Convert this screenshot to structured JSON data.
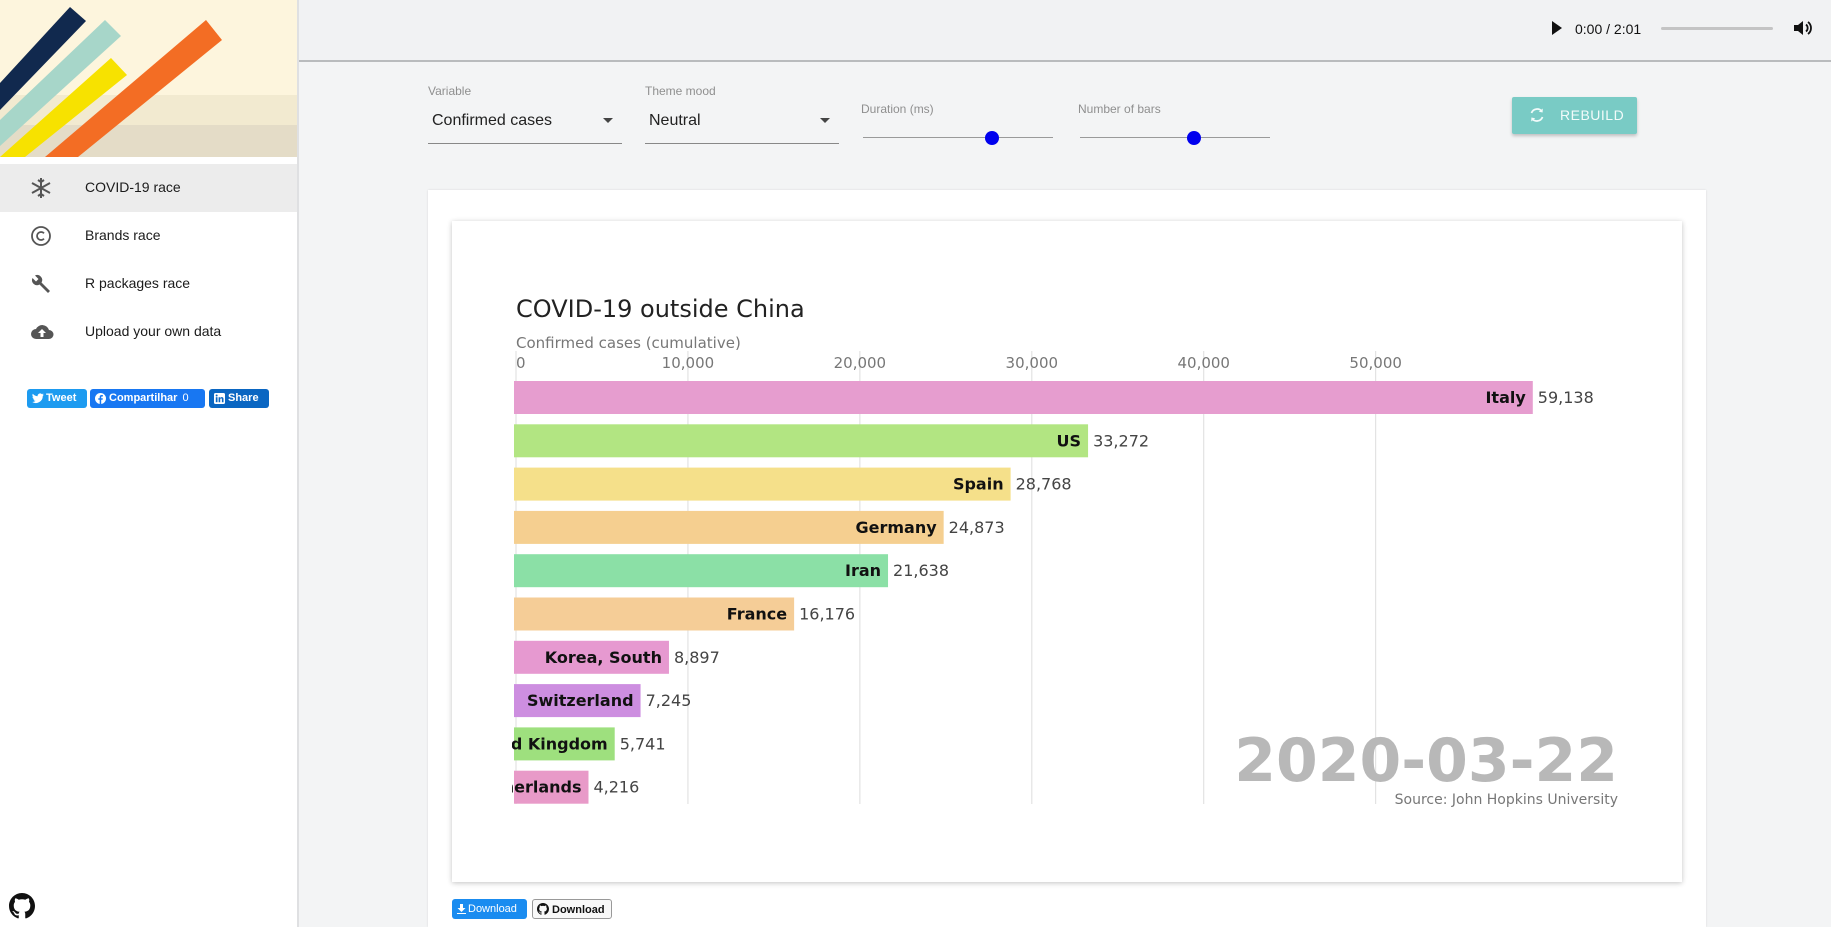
{
  "sidebar": {
    "items": [
      {
        "label": "COVID-19 race",
        "icon": "snowflake-icon",
        "active": true
      },
      {
        "label": "Brands race",
        "icon": "copyright-icon",
        "active": false
      },
      {
        "label": "R packages race",
        "icon": "wrench-icon",
        "active": false
      },
      {
        "label": "Upload your own data",
        "icon": "cloud-upload-icon",
        "active": false
      }
    ],
    "social": {
      "tweet": "Tweet",
      "facebook": "Compartilhar",
      "facebook_count": "0",
      "linkedin": "Share"
    }
  },
  "player": {
    "time": "0:00 / 2:01",
    "play_icon": "play-icon",
    "volume_icon": "volume-icon"
  },
  "controls": {
    "variable": {
      "label": "Variable",
      "value": "Confirmed cases"
    },
    "theme": {
      "label": "Theme mood",
      "value": "Neutral"
    },
    "duration": {
      "label": "Duration (ms)",
      "position": 0.68
    },
    "bars": {
      "label": "Number of bars",
      "position": 0.6
    },
    "rebuild": "REBUILD"
  },
  "chart_data": {
    "type": "bar",
    "title": "COVID-19 outside China",
    "subtitle": "Confirmed cases (cumulative)",
    "date": "2020-03-22",
    "source": "Source: John Hopkins University",
    "xlim": [
      0,
      62000
    ],
    "ticks": [
      0,
      10000,
      20000,
      30000,
      40000,
      50000
    ],
    "tick_labels": [
      "0",
      "10,000",
      "20,000",
      "30,000",
      "40,000",
      "50,000"
    ],
    "grid": true,
    "bars": [
      {
        "label": "Italy",
        "value": 59138,
        "value_label": "59,138",
        "color": "#e69dcf"
      },
      {
        "label": "US",
        "value": 33272,
        "value_label": "33,272",
        "color": "#b2e582"
      },
      {
        "label": "Spain",
        "value": 28768,
        "value_label": "28,768",
        "color": "#f5e08a"
      },
      {
        "label": "Germany",
        "value": 24873,
        "value_label": "24,873",
        "color": "#f5cf90"
      },
      {
        "label": "Iran",
        "value": 21638,
        "value_label": "21,638",
        "color": "#8be0a6"
      },
      {
        "label": "France",
        "value": 16176,
        "value_label": "16,176",
        "color": "#f5cd97"
      },
      {
        "label": "Korea, South",
        "value": 8897,
        "value_label": "8,897",
        "color": "#e699d0"
      },
      {
        "label": "Switzerland",
        "value": 7245,
        "value_label": "7,245",
        "color": "#cd8ee0"
      },
      {
        "label": "United Kingdom",
        "value": 5741,
        "value_label": "5,741",
        "color": "#9ee07e"
      },
      {
        "label": "Netherlands",
        "value": 4216,
        "value_label": "4,216",
        "color": "#e89ac8"
      }
    ]
  },
  "downloads": {
    "download1": "Download",
    "download2": "Download"
  }
}
